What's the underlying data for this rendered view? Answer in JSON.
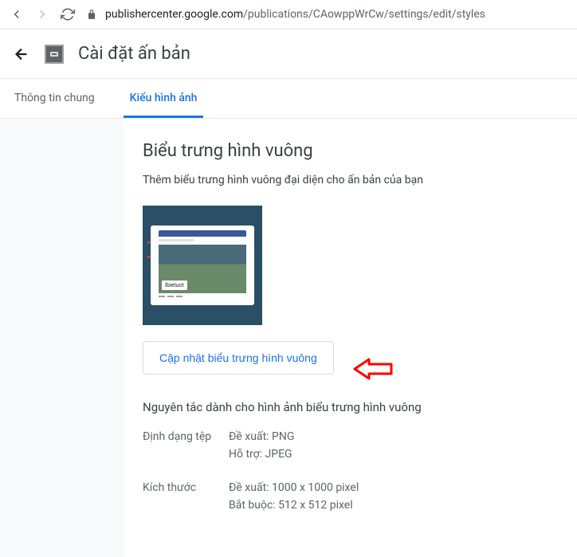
{
  "browser": {
    "url_domain": "publishercenter.google.com",
    "url_path": "/publications/CAowppWrCw/settings/edit/styles"
  },
  "header": {
    "title": "Cài đặt ấn bản"
  },
  "tabs": {
    "general": "Thông tin chung",
    "image_styles": "Kiểu hình ảnh"
  },
  "section": {
    "title": "Biểu trưng hình vuông",
    "description": "Thêm biểu trưng hình vuông đại diện cho ấn bản của bạn",
    "preview_badge": "Ibietuot",
    "update_button": "Cập nhật biểu trưng hình vuông",
    "guidelines_title": "Nguyên tắc dành cho hình ảnh biểu trưng hình vuông"
  },
  "specs": {
    "file_format": {
      "label": "Định dạng tệp",
      "recommended": "Đề xuất: PNG",
      "supported": "Hỗ trợ: JPEG"
    },
    "dimensions": {
      "label": "Kích thước",
      "recommended": "Đề xuất: 1000 x 1000 pixel",
      "required": "Bắt buộc: 512 x 512 pixel"
    }
  }
}
